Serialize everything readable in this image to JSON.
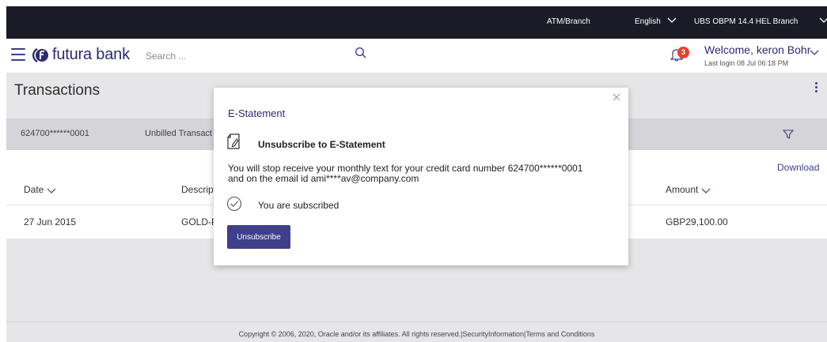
{
  "topbar": {
    "atm_branch": "ATM/Branch",
    "language": "English",
    "branch": "UBS OBPM 14.4 HEL Branch"
  },
  "header": {
    "logo_text": "futura bank",
    "search_placeholder": "Search ...",
    "notification_count": "3",
    "welcome": "Welcome, keron Bohr",
    "last_login": "Last login 08 Jul 06:18 PM"
  },
  "page": {
    "title": "Transactions",
    "account_number": "624700******0001",
    "tab_label": "Unbilled Transact",
    "download": "Download",
    "columns": {
      "date": "Date",
      "description": "Descript",
      "amount": "Amount"
    },
    "rows": [
      {
        "date": "27 Jun 2015",
        "description": "GOLD-P",
        "amount": "GBP29,100.00"
      }
    ]
  },
  "modal": {
    "title": "E-Statement",
    "subtitle": "Unsubscribe to E-Statement",
    "message_line1": "You will stop receive your monthly text for your credit card number 624700******0001",
    "message_line2": "and on the email id ami****av@company.com",
    "status": "You are subscribed",
    "button": "Unsubscribe"
  },
  "footer": {
    "text": "Copyright © 2006, 2020, Oracle and/or its affiliates. All rights reserved.|SecurityInformation|Terms and Conditions"
  },
  "colors": {
    "brand": "#3d3d8f",
    "topbar": "#1a1b26",
    "badge": "#e8402e"
  }
}
